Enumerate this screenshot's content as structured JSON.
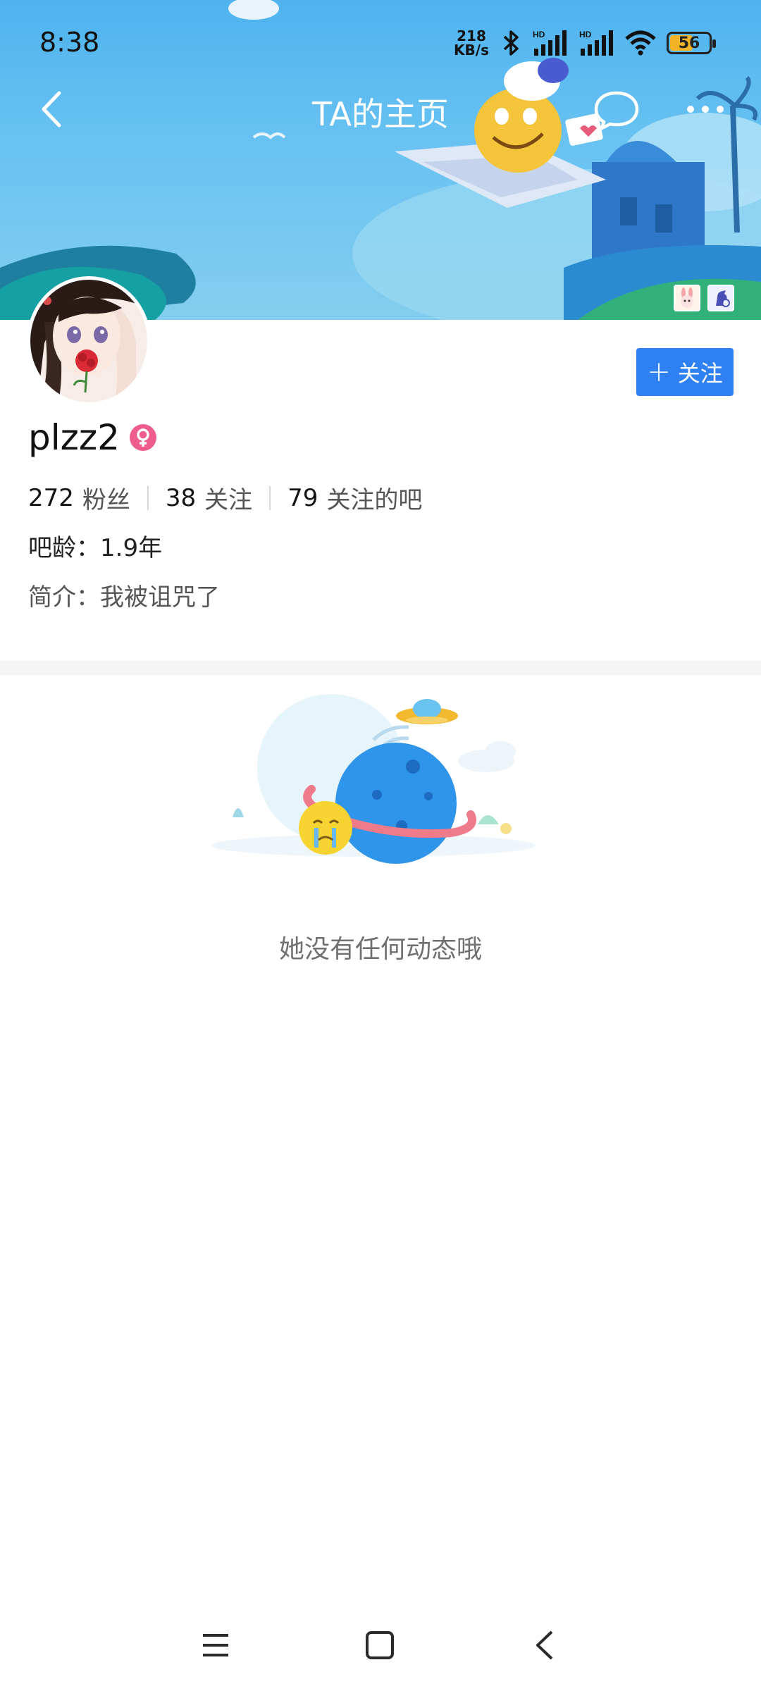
{
  "status_bar": {
    "time": "8:38",
    "net_speed_value": "218",
    "net_speed_unit": "KB/s",
    "battery_level": "56",
    "icons": [
      "bluetooth-icon",
      "signal-hd-icon",
      "signal-hd-icon",
      "wifi-icon",
      "battery-icon"
    ]
  },
  "header": {
    "title": "TA的主页",
    "back_icon": "chevron-left-icon",
    "chat_icon": "chat-bubble-icon",
    "more_icon": "more-dots-icon",
    "banner_badges": [
      "rabbit-badge-icon",
      "horse-badge-icon"
    ]
  },
  "profile": {
    "username": "plzz2",
    "gender_icon": "female-icon",
    "follow_button_label": "关注",
    "stats": [
      {
        "value": "272",
        "label": "粉丝"
      },
      {
        "value": "38",
        "label": "关注"
      },
      {
        "value": "79",
        "label": "关注的吧"
      }
    ],
    "bar_age": "吧龄：1.9年",
    "bio": "简介：我被诅咒了"
  },
  "feed": {
    "empty_message": "她没有任何动态哦"
  },
  "system_nav": {
    "buttons": [
      "menu-icon",
      "home-icon",
      "back-icon"
    ]
  },
  "colors": {
    "accent_blue": "#2f80f2",
    "banner_top": "#4fb3ef",
    "female_pink": "#ef5c8e",
    "muted_text": "#707070"
  }
}
